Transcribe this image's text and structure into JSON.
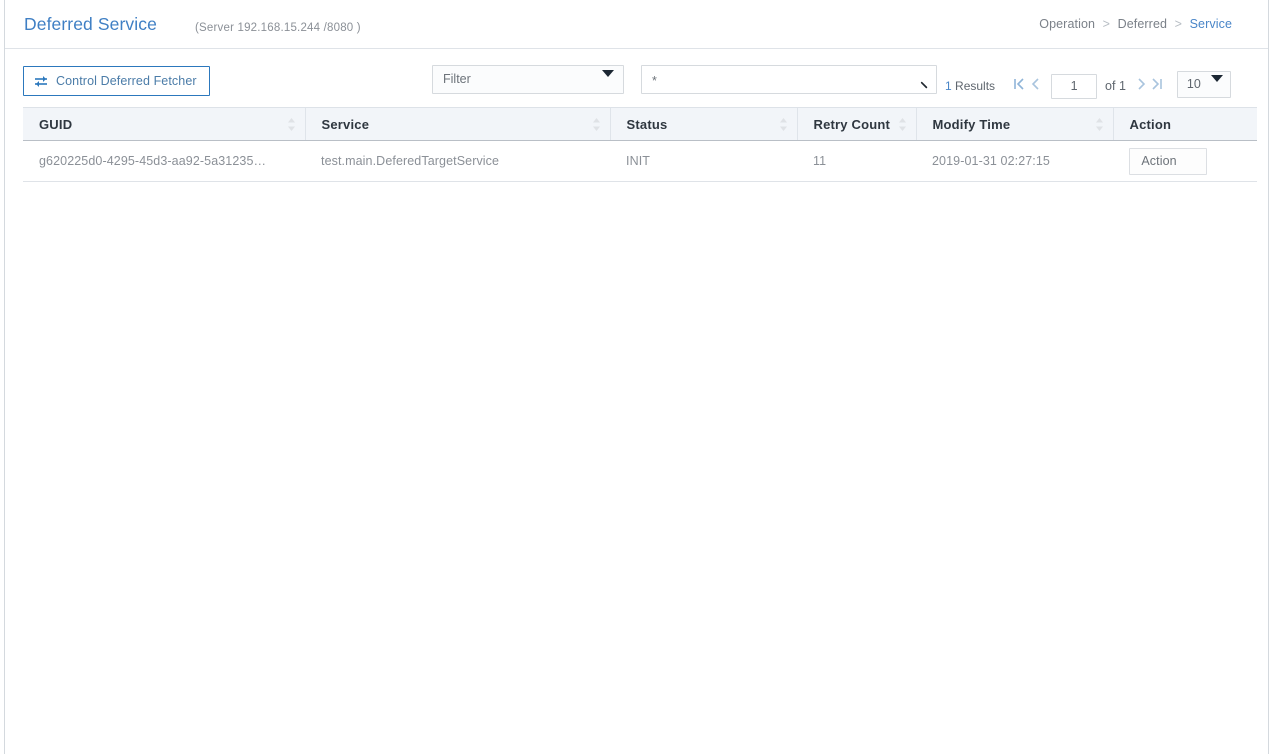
{
  "header": {
    "title": "Deferred Service",
    "server_info": "(Server  192.168.15.244 /8080 )",
    "breadcrumb": {
      "items": [
        "Operation",
        "Deferred",
        "Service"
      ],
      "separator": ">"
    }
  },
  "toolbar": {
    "control_fetcher_label": "Control Deferred Fetcher",
    "control_fetcher_icon": "sliders-icon",
    "filter": {
      "selected": "Filter",
      "icon": "chevron-down-icon"
    },
    "search": {
      "value": "*",
      "placeholder": "",
      "icon": "search-icon"
    },
    "pagination": {
      "results_count": "1",
      "results_label": "Results",
      "first_icon": "first-page-icon",
      "prev_icon": "prev-page-icon",
      "page_value": "1",
      "of_label": "of 1",
      "next_icon": "next-page-icon",
      "last_icon": "last-page-icon",
      "page_size": "10",
      "page_size_icon": "chevron-down-icon"
    }
  },
  "table": {
    "columns": [
      {
        "label": "GUID",
        "sortable": true
      },
      {
        "label": "Service",
        "sortable": true
      },
      {
        "label": "Status",
        "sortable": true
      },
      {
        "label": "Retry Count",
        "sortable": true
      },
      {
        "label": "Modify Time",
        "sortable": true
      },
      {
        "label": "Action",
        "sortable": false
      }
    ],
    "rows": [
      {
        "guid": "g620225d0-4295-45d3-aa92-5a31235…",
        "service": "test.main.DeferedTargetService",
        "status": "INIT",
        "retry_count": "11",
        "modify_time": "2019-01-31 02:27:15",
        "action_label": "Action"
      }
    ]
  },
  "colors": {
    "accent_blue": "#3f7fc4",
    "link_blue": "#4a86c8",
    "button_border_blue": "#2c78bd",
    "header_bg": "#f2f5f9",
    "text_gray": "#8b9097",
    "border_gray": "#dfe3e8"
  }
}
